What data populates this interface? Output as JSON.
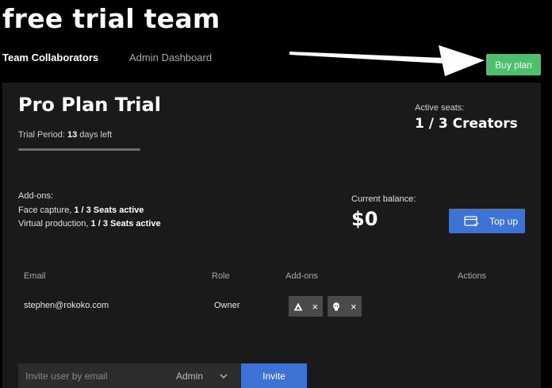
{
  "header": {
    "title": "free trial team",
    "tabs": [
      {
        "label": "Team Collaborators",
        "active": true
      },
      {
        "label": "Admin Dashboard",
        "active": false
      }
    ],
    "buy_label": "Buy plan"
  },
  "plan": {
    "title": "Pro Plan Trial",
    "trial_label": "Trial Period:",
    "trial_days": "13",
    "trial_suffix": "days left",
    "trial_progress_fraction": 1.0,
    "seats_label": "Active seats:",
    "seats_value": "1 / 3 Creators",
    "addons_title": "Add-ons:",
    "addons": [
      {
        "label": "Face capture,",
        "value": "1 / 3 Seats active"
      },
      {
        "label": "Virtual production,",
        "value": "1 / 3 Seats active"
      }
    ],
    "balance_label": "Current balance:",
    "balance_value": "$0",
    "topup_label": "Top up"
  },
  "table": {
    "headers": {
      "email": "Email",
      "role": "Role",
      "addons": "Add-ons",
      "actions": "Actions"
    },
    "rows": [
      {
        "email": "stephen@rokoko.com",
        "role": "Owner",
        "addon_icons": [
          "virtual-production-icon",
          "face-capture-icon"
        ],
        "remove_glyph": "×"
      }
    ]
  },
  "invite": {
    "placeholder": "Invite user by email",
    "role_value": "Admin",
    "button_label": "Invite"
  },
  "colors": {
    "accent_green": "#4fbe6e",
    "accent_blue": "#3c73d4",
    "panel_bg": "#1a1a1a",
    "page_bg": "#000000"
  }
}
